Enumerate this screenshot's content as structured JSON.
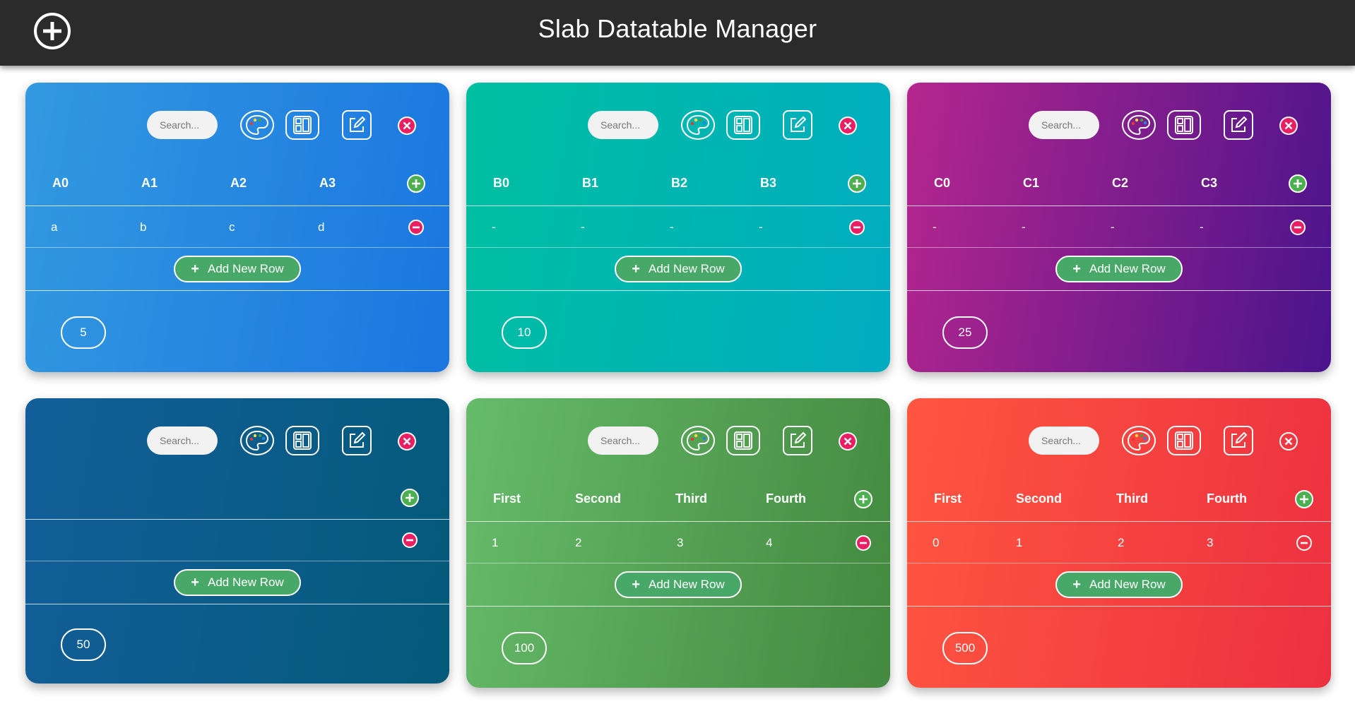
{
  "header": {
    "title": "Slab Datatable Manager",
    "add_icon": "plus-circle-icon"
  },
  "search_placeholder": "Search...",
  "add_row_label": "Add New Row",
  "cards": [
    {
      "id": "a",
      "gradient": [
        "#3399e0",
        "#1a76e0"
      ],
      "columns": [
        "A0",
        "A1",
        "A2",
        "A3"
      ],
      "row": [
        "a",
        "b",
        "c",
        "d"
      ],
      "page_size": "5"
    },
    {
      "id": "b",
      "gradient": [
        "#00bfa0",
        "#00acc1"
      ],
      "columns": [
        "B0",
        "B1",
        "B2",
        "B3"
      ],
      "row": [
        "-",
        "-",
        "-",
        "-"
      ],
      "page_size": "10"
    },
    {
      "id": "c",
      "gradient": [
        "#b5268e",
        "#4a148c"
      ],
      "columns": [
        "C0",
        "C1",
        "C2",
        "C3"
      ],
      "row": [
        "-",
        "-",
        "-",
        "-"
      ],
      "page_size": "25"
    },
    {
      "id": "d",
      "gradient": [
        "#135e9a",
        "#045a7a"
      ],
      "columns": [],
      "row": [],
      "page_size": "50"
    },
    {
      "id": "e",
      "gradient": [
        "#66bb6a",
        "#43893f"
      ],
      "columns": [
        "First",
        "Second",
        "Third",
        "Fourth"
      ],
      "row": [
        "1",
        "2",
        "3",
        "4"
      ],
      "page_size": "100"
    },
    {
      "id": "f",
      "gradient": [
        "#ff5640",
        "#ec3040"
      ],
      "columns": [
        "First",
        "Second",
        "Third",
        "Fourth"
      ],
      "row": [
        "0",
        "1",
        "2",
        "3"
      ],
      "page_size": "500"
    }
  ]
}
